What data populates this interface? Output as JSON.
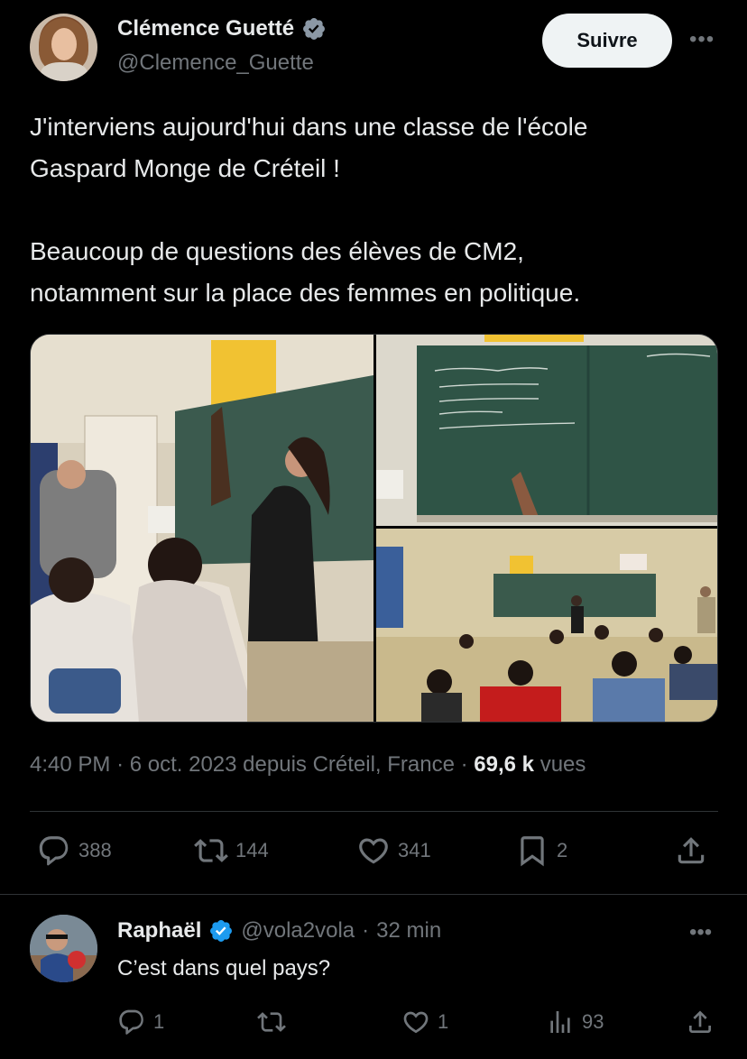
{
  "tweet": {
    "author": {
      "name": "Clémence Guetté",
      "handle": "@Clemence_Guette"
    },
    "follow_label": "Suivre",
    "text_lines": [
      "J'interviens aujourd'hui dans une classe de l'école",
      "Gaspard Monge de Créteil !",
      "Beaucoup de questions des élèves de CM2,",
      "notamment sur la place des femmes en politique."
    ],
    "meta": {
      "time": "4:40 PM",
      "date": "6 oct. 2023",
      "location": "depuis Créteil, France",
      "views_count": "69,6 k",
      "views_label": "vues"
    },
    "stats": {
      "replies": "388",
      "retweets": "144",
      "likes": "341",
      "bookmarks": "2"
    }
  },
  "reply": {
    "name": "Raphaël",
    "handle": "@vola2vola",
    "time": "32 min",
    "text": "C’est dans quel pays?",
    "stats": {
      "replies": "1",
      "likes": "1",
      "views": "93"
    }
  },
  "colors": {
    "background": "#000000",
    "text": "#e7e9ea",
    "muted": "#71767b",
    "verified": "#1d9bf0",
    "follow_button": "#eff3f4"
  }
}
